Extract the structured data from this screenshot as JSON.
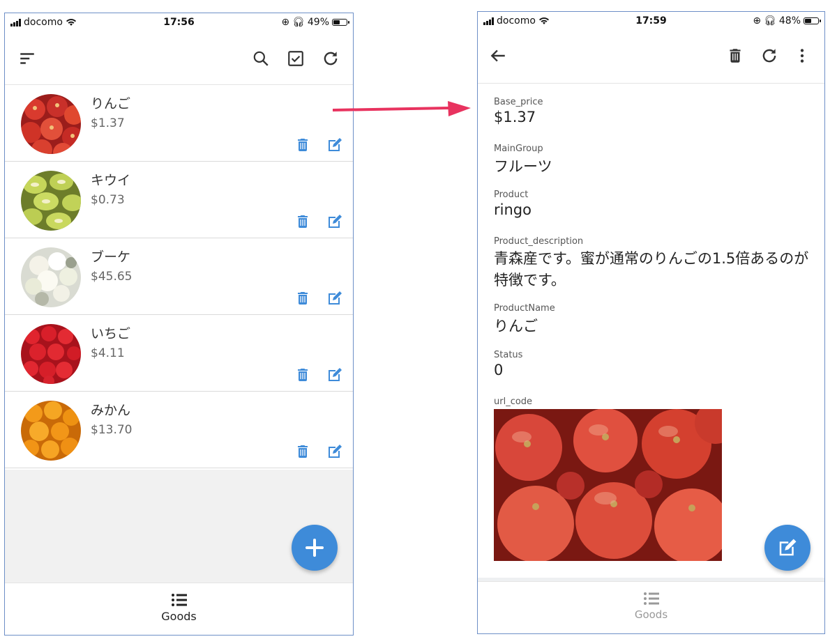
{
  "left": {
    "status": {
      "carrier": "docomo",
      "time": "17:56",
      "battery": "49%",
      "battery_level": 0.49
    },
    "items": [
      {
        "name": "りんご",
        "price": "$1.37",
        "image": "apples"
      },
      {
        "name": "キウイ",
        "price": "$0.73",
        "image": "kiwi"
      },
      {
        "name": "ブーケ",
        "price": "$45.65",
        "image": "bouquet"
      },
      {
        "name": "いちご",
        "price": "$4.11",
        "image": "strawberries"
      },
      {
        "name": "みかん",
        "price": "$13.70",
        "image": "oranges"
      }
    ],
    "bottom_tab": "Goods"
  },
  "right": {
    "status": {
      "carrier": "docomo",
      "time": "17:59",
      "battery": "48%",
      "battery_level": 0.48
    },
    "fields": [
      {
        "label": "Base_price",
        "value": "$1.37"
      },
      {
        "label": "MainGroup",
        "value": "フルーツ"
      },
      {
        "label": "Product",
        "value": "ringo"
      },
      {
        "label": "Product_description",
        "value": "青森産です。蜜が通常のりんごの1.5倍あるのが特徴です。"
      },
      {
        "label": "ProductName",
        "value": "りんご"
      },
      {
        "label": "Status",
        "value": "0"
      },
      {
        "label": "url_code",
        "value": ""
      }
    ],
    "bottom_tab": "Goods"
  },
  "colors": {
    "accent": "#3e8bd9",
    "arrow": "#e8335f",
    "divider": "#dadada"
  }
}
